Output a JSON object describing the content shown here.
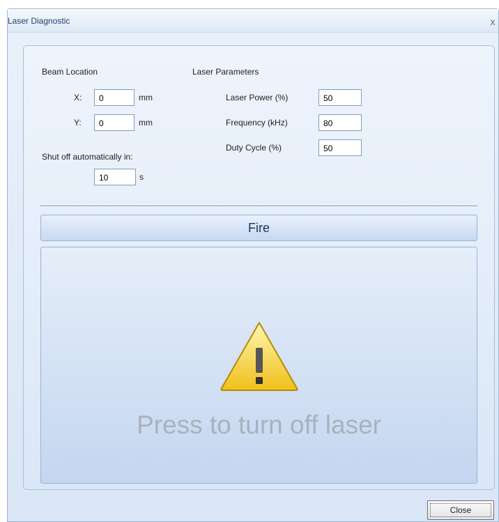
{
  "window": {
    "title": "Laser Diagnostic",
    "close_glyph": "x"
  },
  "beam_location": {
    "heading": "Beam Location",
    "x_label": "X:",
    "x_value": "0",
    "y_label": "Y:",
    "y_value": "0",
    "unit": "mm"
  },
  "shutoff": {
    "label": "Shut off automatically in:",
    "value": "10",
    "unit": "s"
  },
  "laser_parameters": {
    "heading": "Laser Parameters",
    "power_label": "Laser Power (%)",
    "power_value": "50",
    "frequency_label": "Frequency (kHz)",
    "frequency_value": "80",
    "duty_label": "Duty Cycle (%)",
    "duty_value": "50"
  },
  "fire_button": {
    "label": "Fire"
  },
  "warning_panel": {
    "icon": "warning-icon",
    "message": "Press to turn off laser",
    "colors": {
      "triangle_top": "#fff6b0",
      "triangle_bottom": "#f0c01a",
      "text": "#a9b2bd"
    }
  },
  "close_button": {
    "label": "Close"
  }
}
